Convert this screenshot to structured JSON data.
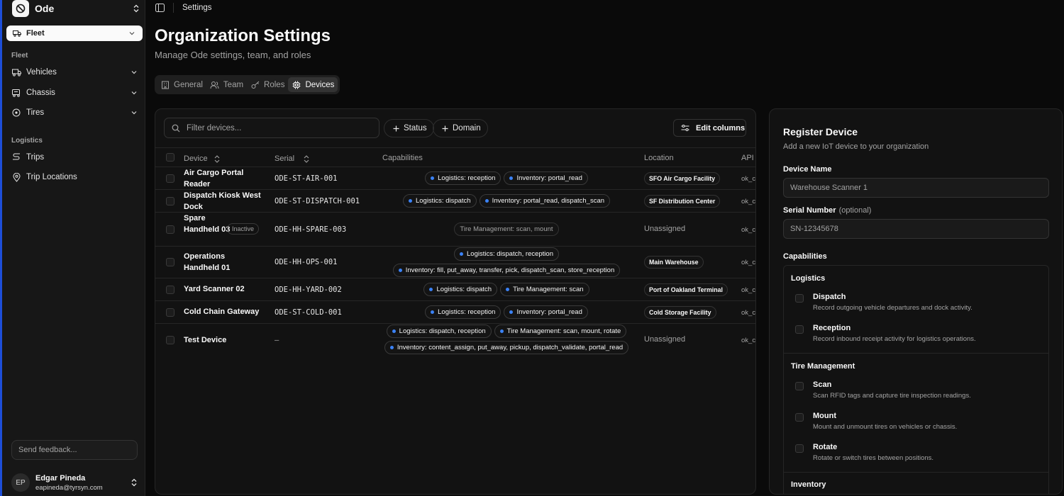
{
  "sidebar": {
    "brand": "Ode",
    "fleet_select": "Fleet",
    "groups": [
      {
        "label": "Fleet",
        "items": [
          {
            "label": "Vehicles"
          },
          {
            "label": "Chassis"
          },
          {
            "label": "Tires"
          }
        ]
      },
      {
        "label": "Logistics",
        "items": [
          {
            "label": "Trips"
          },
          {
            "label": "Trip Locations"
          }
        ]
      }
    ],
    "feedback_placeholder": "Send feedback...",
    "user": {
      "initials": "EP",
      "name": "Edgar Pineda",
      "email": "eapineda@tyrsyn.com"
    }
  },
  "topbar": {
    "breadcrumb": "Settings"
  },
  "page": {
    "title": "Organization Settings",
    "subtitle": "Manage Ode settings, team, and roles",
    "tabs": [
      {
        "label": "General"
      },
      {
        "label": "Team"
      },
      {
        "label": "Roles"
      },
      {
        "label": "Devices",
        "active": true
      }
    ]
  },
  "devices": {
    "filter_placeholder": "Filter devices...",
    "filters": [
      "Status",
      "Domain"
    ],
    "edit_columns_label": "Edit columns",
    "columns": [
      "Device",
      "Serial",
      "Capabilities",
      "Location",
      "API"
    ],
    "rows": [
      {
        "name": "Air Cargo Portal Reader",
        "serial": "ODE-ST-AIR-001",
        "caps": [
          [
            "Logistics: reception",
            "Inventory: portal_read"
          ]
        ],
        "location": "SFO Air Cargo Facility",
        "api": "ok_c"
      },
      {
        "name": "Dispatch Kiosk West Dock",
        "serial": "ODE-ST-DISPATCH-001",
        "caps": [
          [
            "Logistics: dispatch",
            "Inventory: portal_read, dispatch_scan"
          ]
        ],
        "location": "SF Distribution Center",
        "api": "ok_c"
      },
      {
        "name": "Spare Handheld 03",
        "badge": "Inactive",
        "serial": "ODE-HH-SPARE-003",
        "caps_muted": "Tire Management: scan, mount",
        "location_text": "Unassigned",
        "api": "ok_c"
      },
      {
        "name": "Operations Handheld 01",
        "serial": "ODE-HH-OPS-001",
        "caps": [
          [
            "Logistics: dispatch, reception"
          ],
          [
            "Inventory: fill, put_away, transfer, pick, dispatch_scan, store_reception"
          ]
        ],
        "location": "Main Warehouse",
        "api": "ok_c"
      },
      {
        "name": "Yard Scanner 02",
        "serial": "ODE-HH-YARD-002",
        "caps": [
          [
            "Logistics: dispatch",
            "Tire Management: scan"
          ]
        ],
        "location": "Port of Oakland Terminal",
        "api": "ok_c"
      },
      {
        "name": "Cold Chain Gateway",
        "serial": "ODE-ST-COLD-001",
        "caps": [
          [
            "Logistics: reception",
            "Inventory: portal_read"
          ]
        ],
        "location": "Cold Storage Facility",
        "api": "ok_c"
      },
      {
        "name": "Test Device",
        "serial": "—",
        "caps": [
          [
            "Logistics: dispatch, reception",
            "Tire Management: scan, mount, rotate"
          ],
          [
            "Inventory: content_assign, put_away, pickup, dispatch_validate, portal_read"
          ]
        ],
        "location_text": "Unassigned",
        "api": "ok_c"
      }
    ]
  },
  "register": {
    "title": "Register Device",
    "subtitle": "Add a new IoT device to your organization",
    "device_name_label": "Device Name",
    "device_name_placeholder": "Warehouse Scanner 1",
    "serial_label": "Serial Number",
    "serial_optional": "(optional)",
    "serial_placeholder": "SN-12345678",
    "capabilities_label": "Capabilities",
    "groups": [
      {
        "label": "Logistics",
        "items": [
          {
            "name": "Dispatch",
            "desc": "Record outgoing vehicle departures and dock activity."
          },
          {
            "name": "Reception",
            "desc": "Record inbound receipt activity for logistics operations."
          }
        ]
      },
      {
        "label": "Tire Management",
        "items": [
          {
            "name": "Scan",
            "desc": "Scan RFID tags and capture tire inspection readings."
          },
          {
            "name": "Mount",
            "desc": "Mount and unmount tires on vehicles or chassis."
          },
          {
            "name": "Rotate",
            "desc": "Rotate or switch tires between positions."
          }
        ]
      },
      {
        "label": "Inventory",
        "items": []
      }
    ]
  },
  "colors": {
    "accent": "#3b82f6",
    "background": "#0a0a0a",
    "sidebar": "#171717",
    "border": "#262626"
  }
}
